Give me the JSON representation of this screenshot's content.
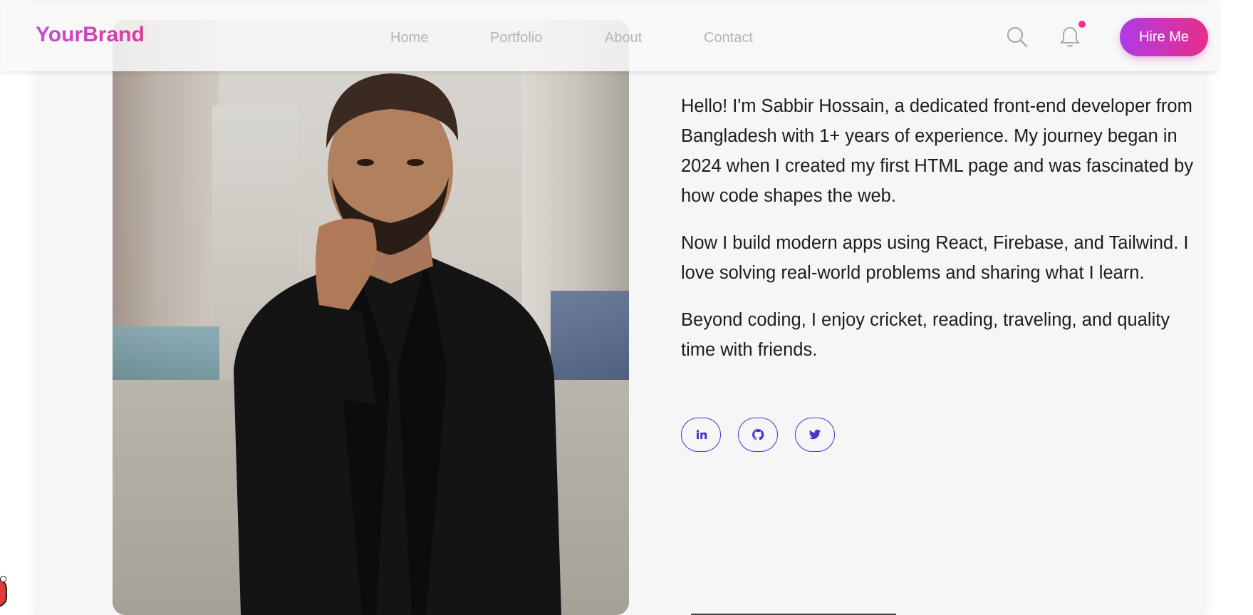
{
  "navbar": {
    "brand": "YourBrand",
    "links": [
      {
        "label": "Home"
      },
      {
        "label": "Portfolio"
      },
      {
        "label": "About"
      },
      {
        "label": "Contact"
      }
    ],
    "search_icon": "search-icon",
    "bell_icon": "bell-icon",
    "has_notification": true,
    "hire_button": "Hire Me"
  },
  "about": {
    "photo_alt": "portrait-photo",
    "paragraphs": [
      "Hello! I'm Sabbir Hossain, a dedicated front-end developer from Bangladesh with 1+ years of experience. My journey began in 2024 when I created my first HTML page and was fascinated by how code shapes the web.",
      "Now I build modern apps using React, Firebase, and Tailwind. I love solving real-world problems and sharing what I learn.",
      "Beyond coding, I enjoy cricket, reading, traveling, and quality time with friends."
    ],
    "socials": [
      {
        "icon": "linkedin-icon"
      },
      {
        "icon": "github-icon"
      },
      {
        "icon": "twitter-icon"
      }
    ]
  },
  "colors": {
    "brand_gradient_start": "#c24dd9",
    "brand_gradient_end": "#e0369a",
    "social_border": "#4338ca",
    "notification_dot": "#f0328f",
    "nav_link": "#b4b4ba"
  }
}
